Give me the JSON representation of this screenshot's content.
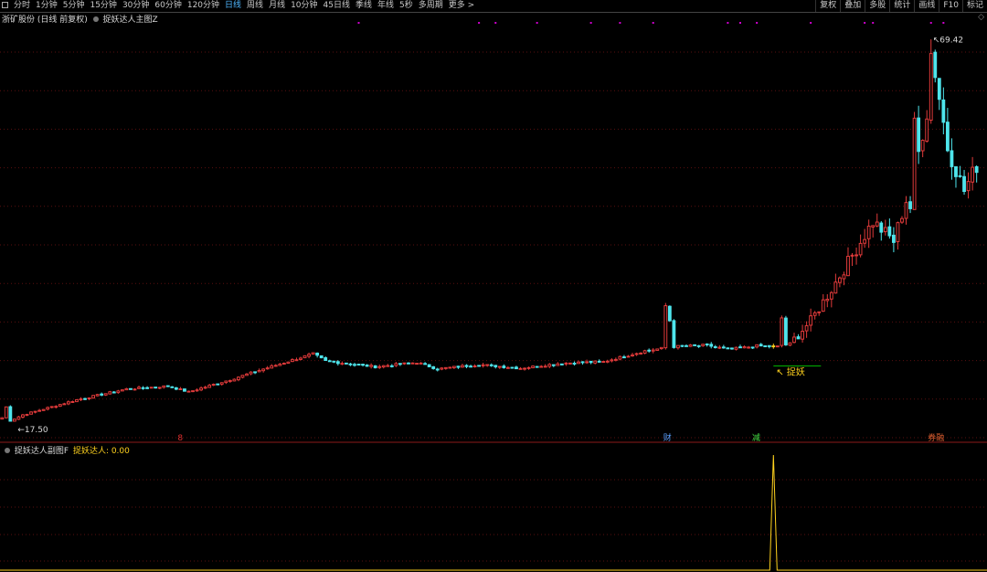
{
  "toolbar": {
    "periods": [
      "分时",
      "1分钟",
      "5分钟",
      "15分钟",
      "30分钟",
      "60分钟",
      "120分钟",
      "日线",
      "周线",
      "月线",
      "10分钟",
      "45日线",
      "季线",
      "年线",
      "5秒",
      "多周期",
      "更多 >"
    ],
    "active_index": 7,
    "right_buttons": [
      "复权",
      "叠加",
      "多股",
      "统计",
      "画线",
      "F10",
      "标记"
    ]
  },
  "main_panel": {
    "stock_name": "浙矿股份",
    "period_info": "(日线 前复权)",
    "indicator": "捉妖达人主图Z",
    "high_label": "69.42",
    "low_label": "17.50",
    "signal_label": "捉妖",
    "event_markers": [
      {
        "text": "8",
        "color": "#e03030"
      },
      {
        "text": "财",
        "color": "#5aa0ff"
      },
      {
        "text": "减",
        "color": "#44dd44"
      },
      {
        "text": "券融",
        "color": "#e06030"
      }
    ],
    "colors": {
      "up": "#e03a3a",
      "down": "#4ee5ec",
      "signal": "#ffd21e",
      "dots": "#cc00cc",
      "signal_line": "#00b300"
    }
  },
  "sub_panel": {
    "indicator": "捉妖达人副图F",
    "value_label": "捉妖达人: 0.00",
    "line_color": "#ffd21e"
  },
  "chart_data": {
    "type": "candlestick",
    "ylim": [
      15,
      73
    ],
    "anchors": [
      [
        0,
        17.9
      ],
      [
        1,
        19.4
      ],
      [
        2,
        17.5
      ],
      [
        5,
        18.3
      ],
      [
        10,
        19.1
      ],
      [
        18,
        20.4
      ],
      [
        30,
        21.9
      ],
      [
        40,
        22.3
      ],
      [
        45,
        21.5
      ],
      [
        55,
        23.2
      ],
      [
        62,
        24.5
      ],
      [
        75,
        26.8
      ],
      [
        78,
        25.8
      ],
      [
        90,
        25.0
      ],
      [
        100,
        25.6
      ],
      [
        105,
        24.7
      ],
      [
        115,
        25.3
      ],
      [
        125,
        24.8
      ],
      [
        135,
        25.5
      ],
      [
        145,
        25.7
      ],
      [
        155,
        27.2
      ],
      [
        162,
        27.8
      ],
      [
        170,
        28.0
      ],
      [
        175,
        27.4
      ],
      [
        178,
        27.6
      ],
      [
        182,
        27.9
      ],
      [
        187,
        27.8
      ],
      [
        190,
        28.2
      ],
      [
        195,
        31.4
      ],
      [
        200,
        35.8
      ],
      [
        210,
        45.2
      ],
      [
        215,
        42.5
      ],
      [
        220,
        52.0
      ],
      [
        225,
        66.0
      ],
      [
        228,
        55.5
      ],
      [
        232,
        49.5
      ],
      [
        235,
        53.0
      ]
    ],
    "big_moves": [
      {
        "i": 160,
        "value": 33.5
      },
      {
        "i": 161,
        "value": 31.4
      },
      {
        "i": 188,
        "value": 31.8
      },
      {
        "i": 219,
        "value": 47.0
      },
      {
        "i": 220,
        "value": 59.6
      },
      {
        "i": 224,
        "value": 68.6
      }
    ],
    "signal_index": 186,
    "dot_indices": [
      86,
      115,
      119,
      129,
      142,
      149,
      157,
      175,
      178,
      182,
      195,
      208,
      210,
      224,
      227
    ],
    "sub_signal": {
      "i": 186,
      "peak": 1.0,
      "baseline": 0.0
    }
  }
}
